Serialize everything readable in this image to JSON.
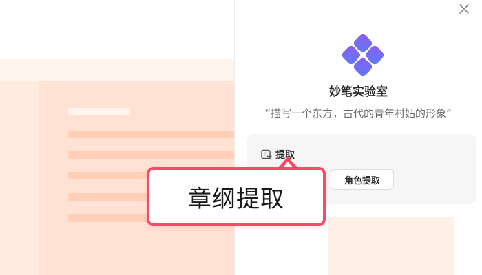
{
  "panel": {
    "app_title": "妙笔实验室",
    "prompt": "“描写一个东方，古代的青年村姑的形象”",
    "close_icon": "close-icon",
    "logo_icon": "clover-logo-icon"
  },
  "card": {
    "head_label": "提取",
    "head_icon": "extract-icon",
    "role_button_label": "角色提取"
  },
  "callout": {
    "label": "章纲提取"
  },
  "colors": {
    "accent_red": "#f94a67",
    "logo_purple": "#7b5cf0",
    "logo_blue": "#5b7cf5",
    "doc_peach": "#ffe2d3"
  }
}
